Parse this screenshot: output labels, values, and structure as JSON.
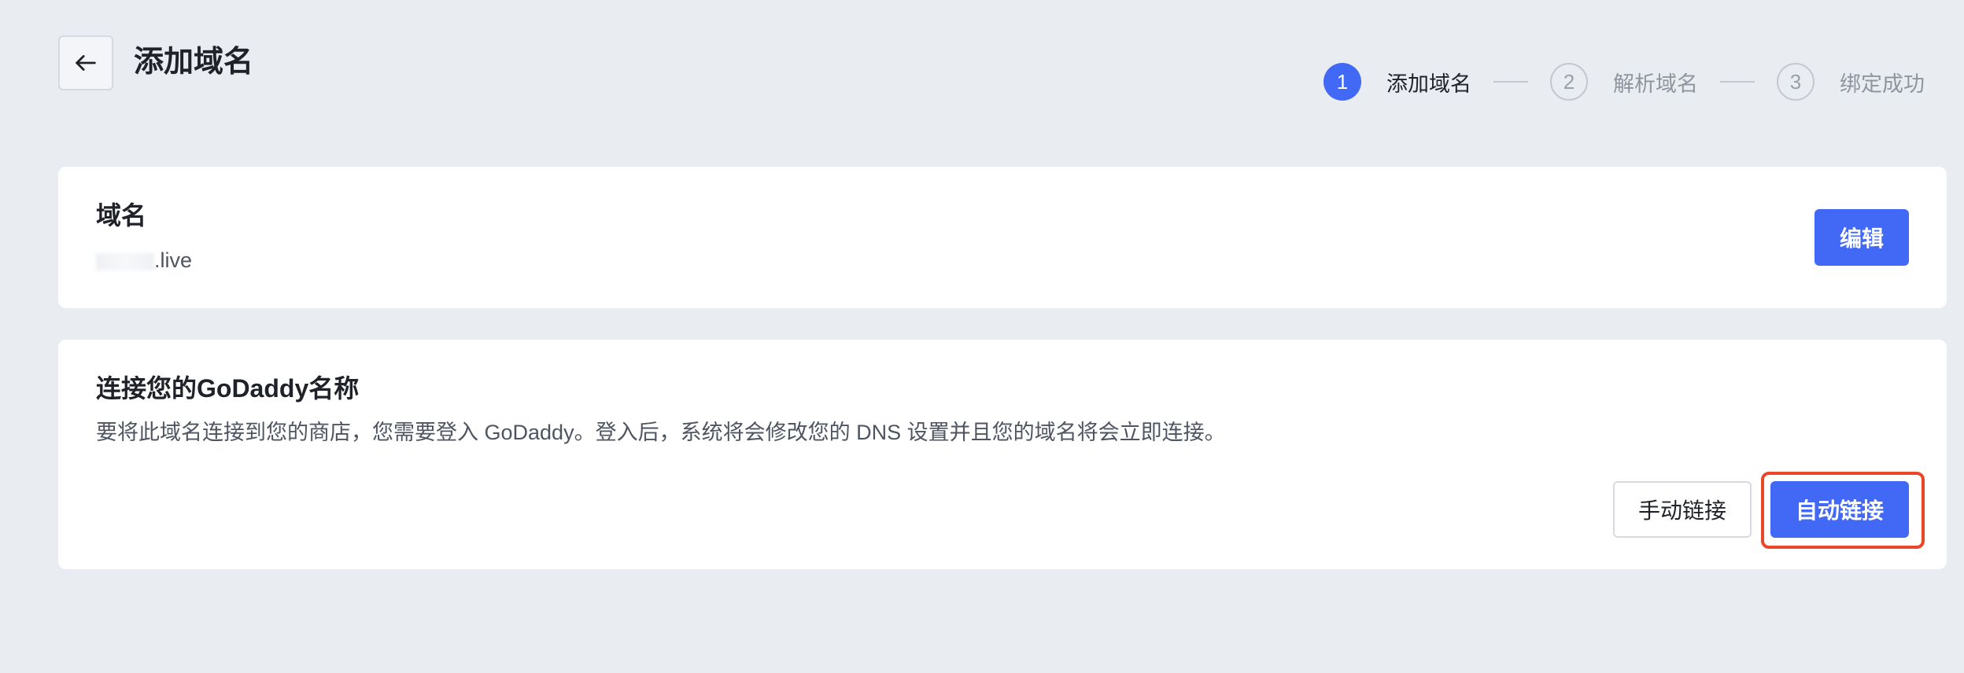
{
  "header": {
    "title": "添加域名",
    "back_icon": "arrow-left-icon"
  },
  "steps": [
    {
      "number": "1",
      "label": "添加域名",
      "state": "active"
    },
    {
      "number": "2",
      "label": "解析域名",
      "state": "inactive"
    },
    {
      "number": "3",
      "label": "绑定成功",
      "state": "inactive"
    }
  ],
  "domain_card": {
    "title": "域名",
    "value_suffix": ".live",
    "edit_label": "编辑"
  },
  "connect_card": {
    "title": "连接您的GoDaddy名称",
    "description": "要将此域名连接到您的商店，您需要登入 GoDaddy。登入后，系统将会修改您的 DNS 设置并且您的域名将会立即连接。",
    "manual_label": "手动链接",
    "auto_label": "自动链接"
  },
  "colors": {
    "accent": "#4169f5",
    "background": "#e9ecf1",
    "highlight": "#e8472a"
  }
}
